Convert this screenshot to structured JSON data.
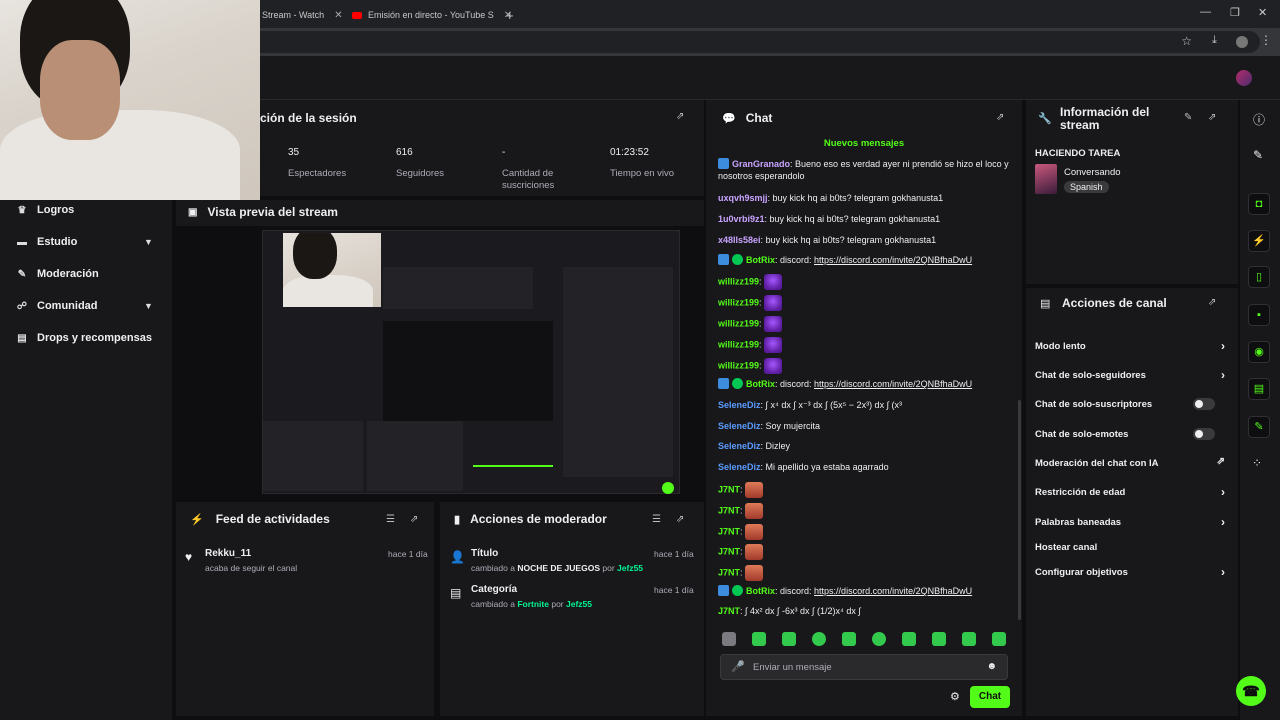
{
  "browser": {
    "tabs": [
      {
        "label": "Stream - Watch"
      },
      {
        "label": "Emisión en directo - YouTube S"
      }
    ],
    "new_tab_symbol": "+"
  },
  "sidebar": {
    "items": [
      {
        "label": "Logros",
        "icon": "trophy-icon"
      },
      {
        "label": "Estudio",
        "icon": "studio-icon",
        "expandable": true
      },
      {
        "label": "Moderación",
        "icon": "wrench-icon"
      },
      {
        "label": "Comunidad",
        "icon": "community-icon",
        "expandable": true
      },
      {
        "label": "Drops y recompensas",
        "icon": "drops-icon"
      }
    ]
  },
  "session": {
    "title": "ción de la sesión",
    "stats": [
      {
        "value": "35",
        "label": "Espectadores"
      },
      {
        "value": "616",
        "label": "Seguidores"
      },
      {
        "value": "-",
        "label": "Cantidad de suscriciones"
      },
      {
        "value": "01:23:52",
        "label": "Tiempo en vivo"
      }
    ]
  },
  "preview": {
    "title": "Vista previa del stream"
  },
  "feed": {
    "title": "Feed de actividades",
    "items": [
      {
        "user": "Rekku_11",
        "text": "acaba de seguir el canal",
        "time": "hace 1 día"
      }
    ]
  },
  "mod_actions": {
    "title": "Acciones de moderador",
    "items": [
      {
        "title": "Título",
        "prefix": "cambiado a",
        "value": "NOCHE DE JUEGOS",
        "by": "por",
        "user": "Jefz55",
        "time": "hace 1 día"
      },
      {
        "title": "Categoría",
        "prefix": "cambiado a",
        "value": "Fortnite",
        "by": "por",
        "user": "Jefz55",
        "time": "hace 1 día"
      }
    ]
  },
  "chat": {
    "title": "Chat",
    "new_messages": "Nuevos mensajes",
    "messages": [
      {
        "user": "GranGranado",
        "color": "#c9a4ff",
        "badge": "blue",
        "text": "Bueno eso es verdad ayer ni prendió se hizo el loco y nosotros esperandolo"
      },
      {
        "user": "uxqvh9smjj",
        "color": "#c9a4ff",
        "text": "buy kick hq ai b0ts? telegram gokhanusta1"
      },
      {
        "user": "1u0vrbi9z1",
        "color": "#c9a4ff",
        "text": "buy kick hq ai b0ts? telegram gokhanusta1"
      },
      {
        "user": "x48lls58ei",
        "color": "#c9a4ff",
        "text": "buy kick hq ai b0ts? telegram gokhanusta1"
      },
      {
        "user": "BotRix",
        "color": "#53fc18",
        "badge": "both",
        "text": "discord:",
        "link": "https://discord.com/invite/2QNBfhaDwU"
      },
      {
        "user": "willizz199",
        "color": "#53fc18",
        "emote": "purple"
      },
      {
        "user": "willizz199",
        "color": "#53fc18",
        "emote": "purple"
      },
      {
        "user": "willizz199",
        "color": "#53fc18",
        "emote": "purple"
      },
      {
        "user": "willizz199",
        "color": "#53fc18",
        "emote": "purple"
      },
      {
        "user": "willizz199",
        "color": "#53fc18",
        "emote": "purple"
      },
      {
        "user": "BotRix",
        "color": "#53fc18",
        "badge": "both",
        "text": "discord:",
        "link": "https://discord.com/invite/2QNBfhaDwU"
      },
      {
        "user": "SeleneDiz",
        "color": "#5b9bff",
        "text": "∫ x⁴ dx ∫ x⁻³ dx ∫ (5x⁵ − 2x³) dx ∫ (x³"
      },
      {
        "user": "SeleneDiz",
        "color": "#5b9bff",
        "text": "Soy mujercita"
      },
      {
        "user": "SeleneDiz",
        "color": "#5b9bff",
        "text": "Dizley"
      },
      {
        "user": "SeleneDiz",
        "color": "#5b9bff",
        "text": "Mi apellido ya estaba agarrado"
      },
      {
        "user": "J7NT",
        "color": "#53fc18",
        "emote": "red"
      },
      {
        "user": "J7NT",
        "color": "#53fc18",
        "emote": "red"
      },
      {
        "user": "J7NT",
        "color": "#53fc18",
        "emote": "red"
      },
      {
        "user": "J7NT",
        "color": "#53fc18",
        "emote": "red"
      },
      {
        "user": "J7NT",
        "color": "#53fc18",
        "emote": "red"
      },
      {
        "user": "BotRix",
        "color": "#53fc18",
        "badge": "both",
        "text": "discord:",
        "link": "https://discord.com/invite/2QNBfhaDwU"
      },
      {
        "user": "J7NT",
        "color": "#53fc18",
        "text": "∫ 4x² dx ∫ -6x³ dx ∫ (1/2)x⁴ dx ∫"
      }
    ],
    "input_placeholder": "Enviar un mensaje",
    "send_label": "Chat"
  },
  "stream_info": {
    "title": "Información del stream",
    "stream_title": "HACIENDO TAREA",
    "category": "Conversando",
    "language": "Spanish"
  },
  "channel_actions": {
    "title": "Acciones de canal",
    "items": [
      {
        "label": "Modo lento",
        "control": "arrow"
      },
      {
        "label": "Chat de solo-seguidores",
        "control": "arrow"
      },
      {
        "label": "Chat de solo-suscriptores",
        "control": "toggle"
      },
      {
        "label": "Chat de solo-emotes",
        "control": "toggle"
      },
      {
        "label": "Moderación del chat con IA",
        "control": "external"
      },
      {
        "label": "Restricción de edad",
        "control": "arrow"
      },
      {
        "label": "Palabras baneadas",
        "control": "arrow"
      },
      {
        "label": "Hostear canal",
        "control": "none"
      },
      {
        "label": "Configurar objetivos",
        "control": "arrow"
      }
    ]
  },
  "colors": {
    "accent": "#53fc18",
    "bg": "#0e0e10",
    "panel": "#18181b"
  }
}
